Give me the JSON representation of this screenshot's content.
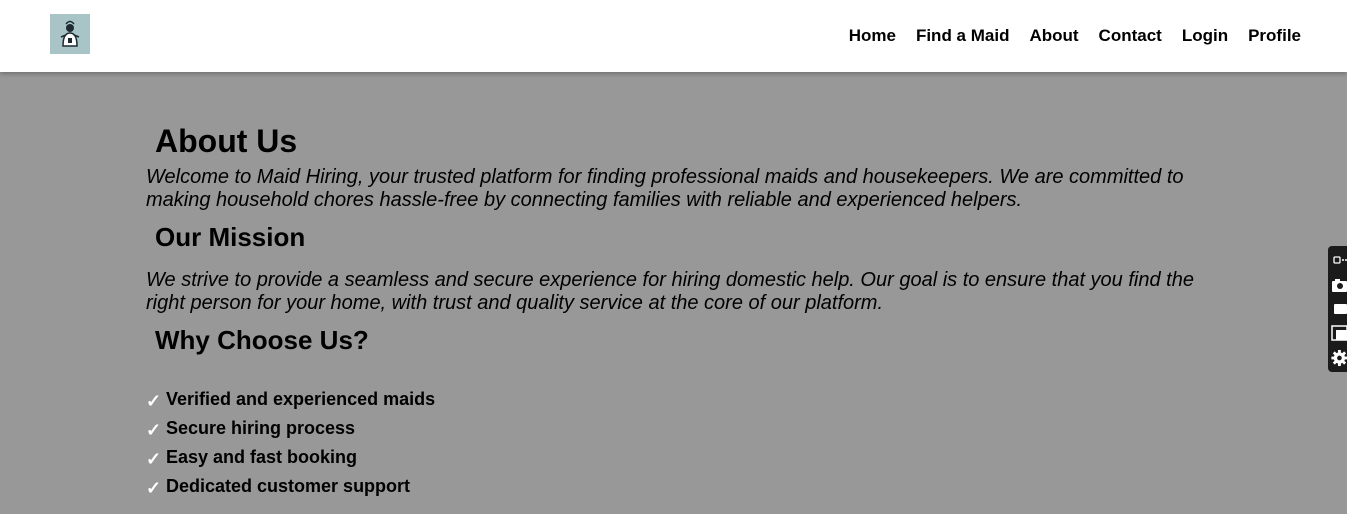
{
  "nav": {
    "logo_icon": "maid-logo-icon",
    "links": [
      "Home",
      "Find a Maid",
      "About",
      "Contact",
      "Login",
      "Profile"
    ]
  },
  "about": {
    "title": "About Us",
    "text": "Welcome to Maid Hiring, your trusted platform for finding professional maids and housekeepers. We are committed to making household chores hassle-free by connecting families with reliable and experienced helpers."
  },
  "mission": {
    "title": "Our Mission",
    "text": "We strive to provide a seamless and secure experience for hiring domestic help. Our goal is to ensure that you find the right person for your home, with trust and quality service at the core of our platform."
  },
  "why": {
    "title": "Why Choose Us?",
    "check_glyph": "✓",
    "features": [
      "Verified and experienced maids",
      "Secure hiring process",
      "Easy and fast booking",
      "Dedicated customer support"
    ]
  },
  "colors": {
    "page_bg": "#989898",
    "navbar_bg": "#ffffff",
    "logo_bg": "#a9c4c6",
    "toolbar_bg": "#1b1b1b"
  },
  "toolbar": {
    "icons": [
      "extension-icon",
      "camera-icon",
      "video-icon",
      "window-icon",
      "gear-icon"
    ]
  }
}
